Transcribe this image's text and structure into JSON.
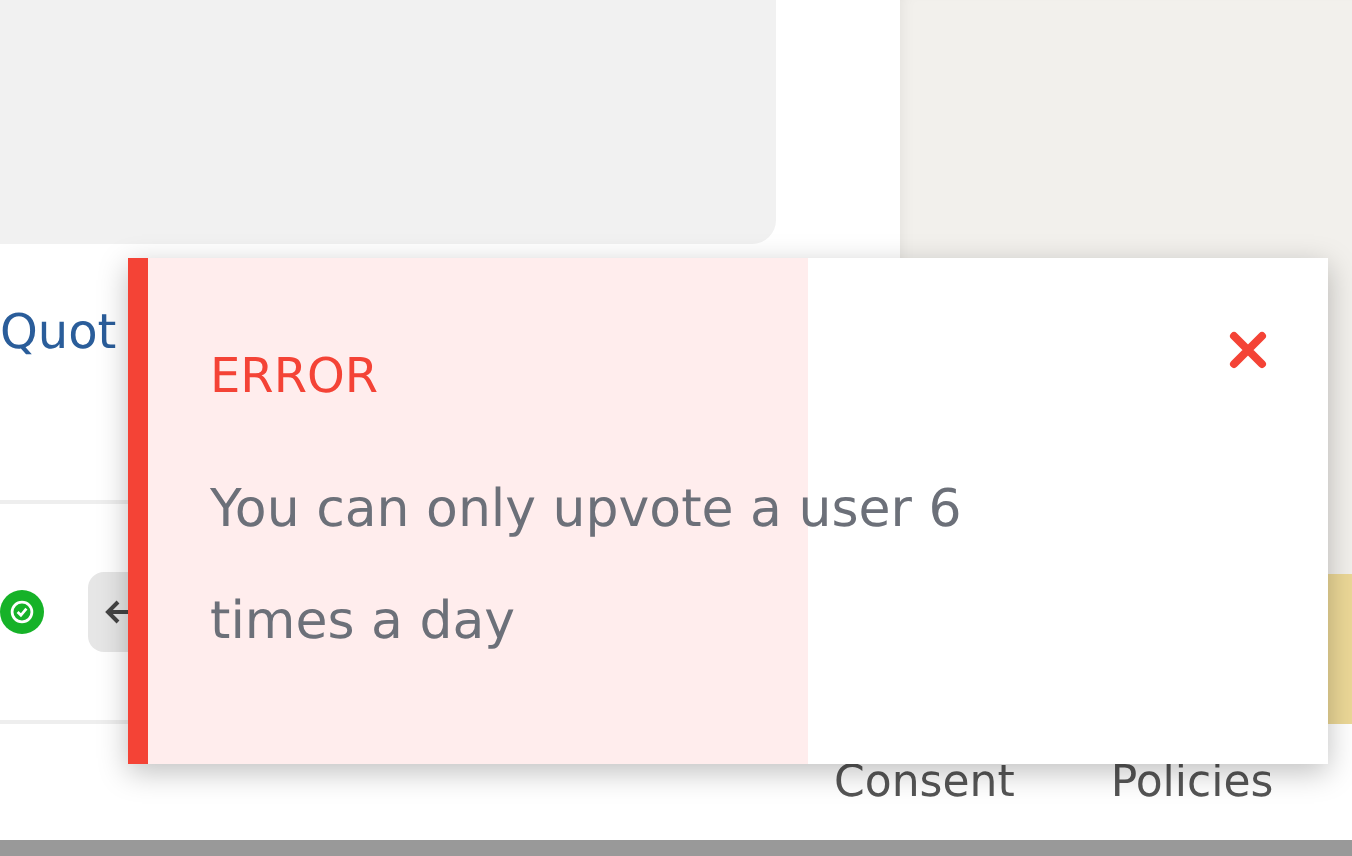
{
  "page": {
    "link": "Quot",
    "footer_links": [
      "Consent",
      "Policies"
    ]
  },
  "toast": {
    "title": "ERROR",
    "message": "You can only upvote a user 6 times a day",
    "level": 0.56
  }
}
